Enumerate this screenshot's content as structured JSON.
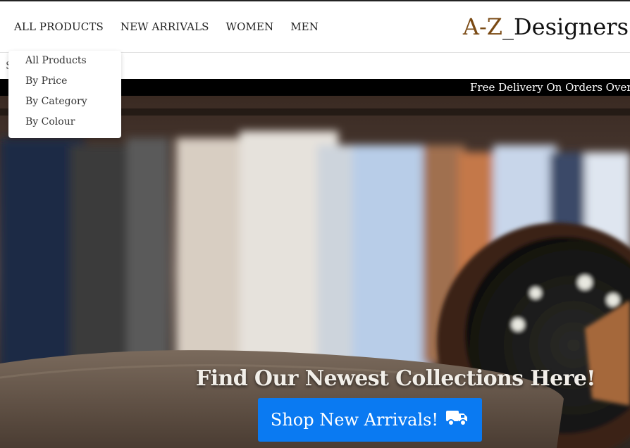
{
  "nav": {
    "links": [
      "ALL PRODUCTS",
      "NEW ARRIVALS",
      "WOMEN",
      "MEN"
    ],
    "brand_part1": "A-Z",
    "brand_part2": "_Designers"
  },
  "subbar": {
    "text": "S"
  },
  "promo": {
    "text": "Free Delivery On Orders Over €"
  },
  "dropdown": {
    "items": [
      "All Products",
      "By Price",
      "By Category",
      "By Colour"
    ]
  },
  "hero": {
    "heading": "Find Our Newest Collections Here!",
    "cta_label": "Shop New Arrivals!",
    "cta_icon": "truck-icon"
  },
  "colors": {
    "accent": "#0a7af2",
    "brand": "#7a4a14",
    "promo_bg": "#000000"
  }
}
